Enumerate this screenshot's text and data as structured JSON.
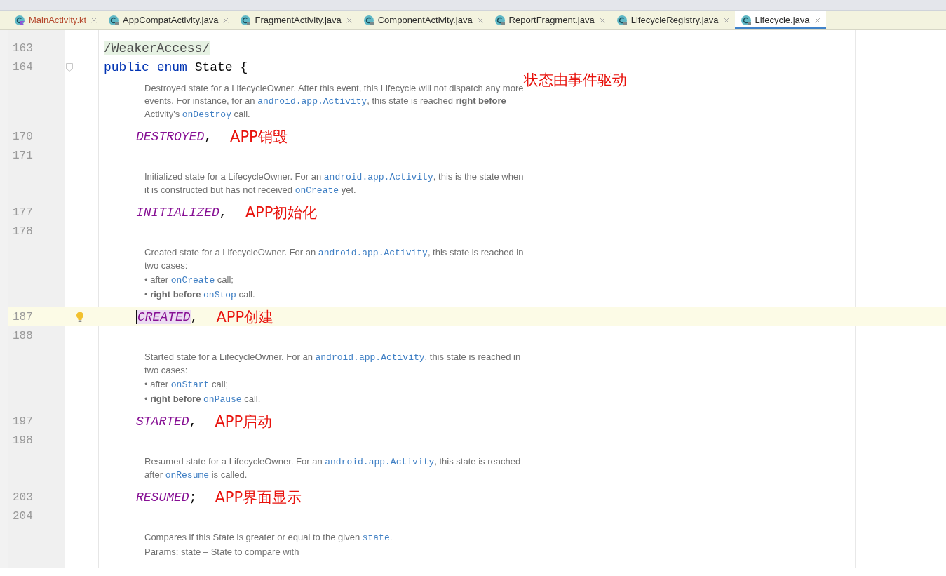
{
  "tabs": [
    {
      "label": "MainActivity.kt",
      "kind": "kotlin",
      "modified": true,
      "selected": false
    },
    {
      "label": "AppCompatActivity.java",
      "kind": "java",
      "modified": false,
      "selected": false
    },
    {
      "label": "FragmentActivity.java",
      "kind": "java",
      "modified": false,
      "selected": false
    },
    {
      "label": "ComponentActivity.java",
      "kind": "java",
      "modified": false,
      "selected": false
    },
    {
      "label": "ReportFragment.java",
      "kind": "java",
      "modified": false,
      "selected": false
    },
    {
      "label": "LifecycleRegistry.java",
      "kind": "java",
      "modified": false,
      "selected": false
    },
    {
      "label": "Lifecycle.java",
      "kind": "java",
      "modified": false,
      "selected": true
    }
  ],
  "editor": {
    "lines": [
      {
        "kind": "code",
        "number": "163",
        "tokens": [
          {
            "text": "/WeakerAccess/",
            "kind": "annotation"
          }
        ]
      },
      {
        "kind": "code",
        "number": "164",
        "foldable": true,
        "tokens": [
          {
            "text": "public ",
            "kind": "keyword"
          },
          {
            "text": "enum ",
            "kind": "keyword"
          },
          {
            "text": "State {",
            "kind": "plain"
          }
        ],
        "callout": "状态由事件驱动",
        "children": [
          {
            "kind": "doc",
            "paragraphs": [
              [
                {
                  "kind": "text",
                  "text": "Destroyed state for a LifecycleOwner. After this event, this Lifecycle will not dispatch any more events. For instance, for an "
                },
                {
                  "kind": "code",
                  "text": "android.app.Activity"
                },
                {
                  "kind": "text",
                  "text": ", this state is reached **right before** Activity's "
                },
                {
                  "kind": "code",
                  "text": "onDestroy"
                },
                {
                  "kind": "text",
                  "text": " call."
                }
              ]
            ]
          },
          {
            "kind": "code",
            "number": "170",
            "tokens": [
              {
                "text": "DESTROYED",
                "kind": "constant"
              },
              {
                "text": ",",
                "kind": "plain"
              }
            ],
            "note": "APP销毁"
          },
          {
            "kind": "code",
            "number": "171"
          },
          {
            "kind": "doc",
            "paragraphs": [
              [
                {
                  "kind": "text",
                  "text": "Initialized state for a LifecycleOwner. For an "
                },
                {
                  "kind": "code",
                  "text": "android.app.Activity"
                },
                {
                  "kind": "text",
                  "text": ", this is the state when it is constructed but has not received "
                },
                {
                  "kind": "code",
                  "text": "onCreate"
                },
                {
                  "kind": "text",
                  "text": " yet."
                }
              ]
            ]
          },
          {
            "kind": "code",
            "number": "177",
            "tokens": [
              {
                "text": "INITIALIZED",
                "kind": "constant"
              },
              {
                "text": ",",
                "kind": "plain"
              }
            ],
            "note": "APP初始化"
          },
          {
            "kind": "code",
            "number": "178"
          },
          {
            "kind": "doc",
            "paragraphs": [
              [
                {
                  "kind": "text",
                  "text": "Created state for a LifecycleOwner. For an "
                },
                {
                  "kind": "code",
                  "text": "android.app.Activity"
                },
                {
                  "kind": "text",
                  "text": ", this state is reached in two cases:"
                }
              ],
              [
                {
                  "kind": "text",
                  "text": "• after "
                },
                {
                  "kind": "code",
                  "text": "onCreate"
                },
                {
                  "kind": "text",
                  "text": " call;"
                }
              ],
              [
                {
                  "kind": "text",
                  "text": "• **right before** "
                },
                {
                  "kind": "code",
                  "text": "onStop"
                },
                {
                  "kind": "text",
                  "text": " call."
                }
              ]
            ]
          },
          {
            "kind": "code",
            "number": "187",
            "current": true,
            "tokens": [
              {
                "text": "CREATED",
                "kind": "constant",
                "highlighted": true
              },
              {
                "text": ",",
                "kind": "plain"
              }
            ],
            "note": "APP创建"
          },
          {
            "kind": "code",
            "number": "188"
          },
          {
            "kind": "doc",
            "paragraphs": [
              [
                {
                  "kind": "text",
                  "text": "Started state for a LifecycleOwner. For an "
                },
                {
                  "kind": "code",
                  "text": "android.app.Activity"
                },
                {
                  "kind": "text",
                  "text": ", this state is reached in two cases:"
                }
              ],
              [
                {
                  "kind": "text",
                  "text": "• after "
                },
                {
                  "kind": "code",
                  "text": "onStart"
                },
                {
                  "kind": "text",
                  "text": " call;"
                }
              ],
              [
                {
                  "kind": "text",
                  "text": "• **right before** "
                },
                {
                  "kind": "code",
                  "text": "onPause"
                },
                {
                  "kind": "text",
                  "text": " call."
                }
              ]
            ]
          },
          {
            "kind": "code",
            "number": "197",
            "tokens": [
              {
                "text": "STARTED",
                "kind": "constant"
              },
              {
                "text": ",",
                "kind": "plain"
              }
            ],
            "note": "APP启动"
          },
          {
            "kind": "code",
            "number": "198"
          },
          {
            "kind": "doc",
            "paragraphs": [
              [
                {
                  "kind": "text",
                  "text": "Resumed state for a LifecycleOwner. For an "
                },
                {
                  "kind": "code",
                  "text": "android.app.Activity"
                },
                {
                  "kind": "text",
                  "text": ", this state is reached after "
                },
                {
                  "kind": "code",
                  "text": "onResume"
                },
                {
                  "kind": "text",
                  "text": " is called."
                }
              ]
            ]
          },
          {
            "kind": "code",
            "number": "203",
            "tokens": [
              {
                "text": "RESUMED",
                "kind": "constant"
              },
              {
                "text": ";",
                "kind": "plain"
              }
            ],
            "note": "APP界面显示"
          },
          {
            "kind": "code",
            "number": "204"
          },
          {
            "kind": "doc",
            "paragraphs": [
              [
                {
                  "kind": "text",
                  "text": "Compares if this State is greater or equal to the given "
                },
                {
                  "kind": "code",
                  "text": "state"
                },
                {
                  "kind": "text",
                  "text": "."
                }
              ],
              [
                {
                  "kind": "text",
                  "text": "Params:  state – State to compare with"
                }
              ]
            ]
          }
        ]
      }
    ]
  }
}
